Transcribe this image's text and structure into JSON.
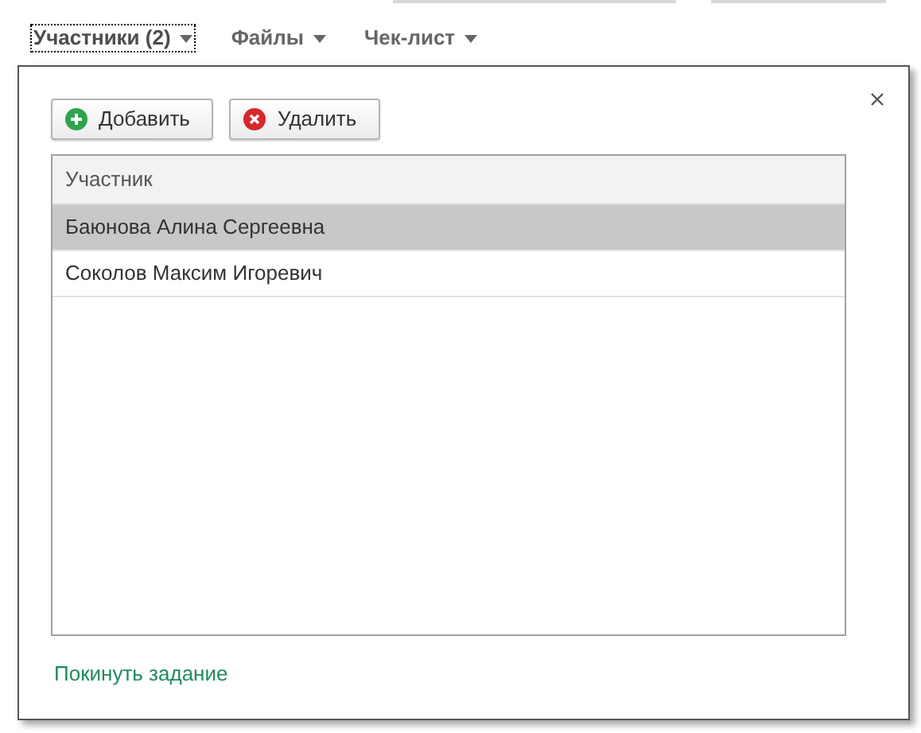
{
  "tabs": [
    {
      "label": "Участники (2)",
      "selected": true
    },
    {
      "label": "Файлы",
      "selected": false
    },
    {
      "label": "Чек-лист",
      "selected": false
    }
  ],
  "dialog": {
    "toolbar": [
      {
        "label": "Добавить",
        "kind": "add"
      },
      {
        "label": "Удалить",
        "kind": "delete"
      }
    ],
    "table": {
      "columns": [
        "Участник"
      ],
      "rows": [
        {
          "cells": [
            "Баюнова Алина Сергеевна"
          ],
          "selected": true
        },
        {
          "cells": [
            "Соколов Максим Игоревич"
          ],
          "selected": false
        }
      ]
    },
    "link": "Покинуть задание"
  }
}
